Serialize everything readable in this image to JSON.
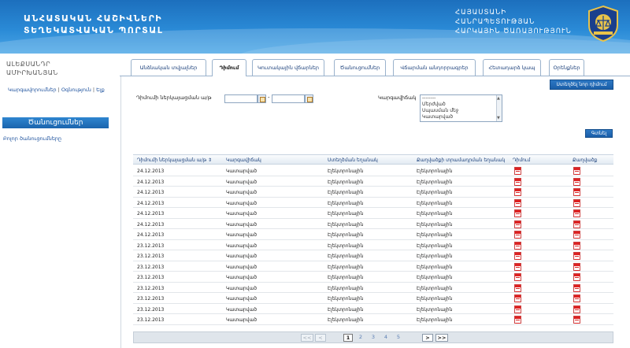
{
  "header": {
    "site_title_line1": "ԱՆՀԱՏԱԿԱՆ ՀԱՇԻՎՆԵՐԻ",
    "site_title_line2": "ՏԵՂԵԿԱՏՎԱԿԱՆ ՊՈՐՏԱԼ",
    "ministry_line1": "ՀԱՅԱՍՏԱՆԻ",
    "ministry_line2": "ՀԱՆՐԱՊԵՏՈՒԹՅԱՆ",
    "ministry_line3": "ՀԱՐԿԱՅԻՆ ԾԱՌԱՅՈՒԹՅՈՒՆ"
  },
  "sidebar": {
    "user_line1": "ԱԼԵՔՍԱՆԴՐ",
    "user_line2": "ԱՄԻՐԽԱՆՅԱՆ",
    "link_settings": "Կարգավորումներ",
    "link_help": "Օգնություն",
    "link_logout": "Ելք",
    "nav_heading": "Ծանուցումներ",
    "nav_all": "Բոլոր ծանուցումները"
  },
  "tabs": [
    {
      "label": "Անձնական տվյալներ",
      "active": false
    },
    {
      "label": "Դիմում",
      "active": true
    },
    {
      "label": "Կուտակային վճարներ",
      "active": false
    },
    {
      "label": "Ծանուցումներ",
      "active": false
    },
    {
      "label": "Վճարման անդորրագրեր",
      "active": false
    },
    {
      "label": "Հետադարձ կապ",
      "active": false
    },
    {
      "label": "Օրենքներ",
      "active": false
    }
  ],
  "toolbar": {
    "new_application_label": "Ստեղծել նոր դիմում",
    "search_label": "Գտնել"
  },
  "filters": {
    "date_label": "Դիմումի ներկայացման ա/թ",
    "date_from": "",
    "date_to": "",
    "status_label": "Կարգավիճակ",
    "status_options": [
      "--------",
      "Մերժված",
      "Սպասման մեջ",
      "Կատարված"
    ]
  },
  "table": {
    "headers": [
      "Դիմումի ներկայացման ա/թ ⇕",
      "Կարգավիճակ",
      "Ստեղծման եղանակ",
      "Քաղվածքի տրամադրման եղանակ",
      "Դիմում",
      "Քաղվածք"
    ],
    "rows": [
      {
        "date": "24.12.2013",
        "status": "Կատարված",
        "creation": "Էլեկտրոնային",
        "delivery": "Էլեկտրոնային"
      },
      {
        "date": "24.12.2013",
        "status": "Կատարված",
        "creation": "Էլեկտրոնային",
        "delivery": "Էլեկտրոնային"
      },
      {
        "date": "24.12.2013",
        "status": "Կատարված",
        "creation": "Էլեկտրոնային",
        "delivery": "Էլեկտրոնային"
      },
      {
        "date": "24.12.2013",
        "status": "Կատարված",
        "creation": "Էլեկտրոնային",
        "delivery": "Էլեկտրոնային"
      },
      {
        "date": "24.12.2013",
        "status": "Կատարված",
        "creation": "Էլեկտրոնային",
        "delivery": "Էլեկտրոնային"
      },
      {
        "date": "24.12.2013",
        "status": "Կատարված",
        "creation": "Էլեկտրոնային",
        "delivery": "Էլեկտրոնային"
      },
      {
        "date": "24.12.2013",
        "status": "Կատարված",
        "creation": "Էլեկտրոնային",
        "delivery": "Էլեկտրոնային"
      },
      {
        "date": "23.12.2013",
        "status": "Կատարված",
        "creation": "Էլեկտրոնային",
        "delivery": "Էլեկտրոնային"
      },
      {
        "date": "23.12.2013",
        "status": "Կատարված",
        "creation": "Էլեկտրոնային",
        "delivery": "Էլեկտրոնային"
      },
      {
        "date": "23.12.2013",
        "status": "Կատարված",
        "creation": "Էլեկտրոնային",
        "delivery": "Էլեկտրոնային"
      },
      {
        "date": "23.12.2013",
        "status": "Կատարված",
        "creation": "Էլեկտրոնային",
        "delivery": "Էլեկտրոնային"
      },
      {
        "date": "23.12.2013",
        "status": "Կատարված",
        "creation": "Էլեկտրոնային",
        "delivery": "Էլեկտրոնային"
      },
      {
        "date": "23.12.2013",
        "status": "Կատարված",
        "creation": "Էլեկտրոնային",
        "delivery": "Էլեկտրոնային"
      },
      {
        "date": "23.12.2013",
        "status": "Կատարված",
        "creation": "Էլեկտրոնային",
        "delivery": "Էլեկտրոնային"
      },
      {
        "date": "23.12.2013",
        "status": "Կատարված",
        "creation": "Էլեկտրոնային",
        "delivery": "Էլեկտրոնային"
      }
    ]
  },
  "pager": {
    "first": "<<",
    "prev": "<",
    "pages": [
      "1",
      "2",
      "3",
      "4",
      "5"
    ],
    "current_page": "1",
    "next": ">",
    "last": ">>"
  },
  "icons": {
    "pdf": "pdf-icon",
    "emblem": "tax-service-emblem",
    "calendar": "calendar-icon"
  },
  "colors": {
    "header_blue": "#2a8ad6",
    "link_blue": "#1a4f9c",
    "pdf_red": "#d22222"
  }
}
